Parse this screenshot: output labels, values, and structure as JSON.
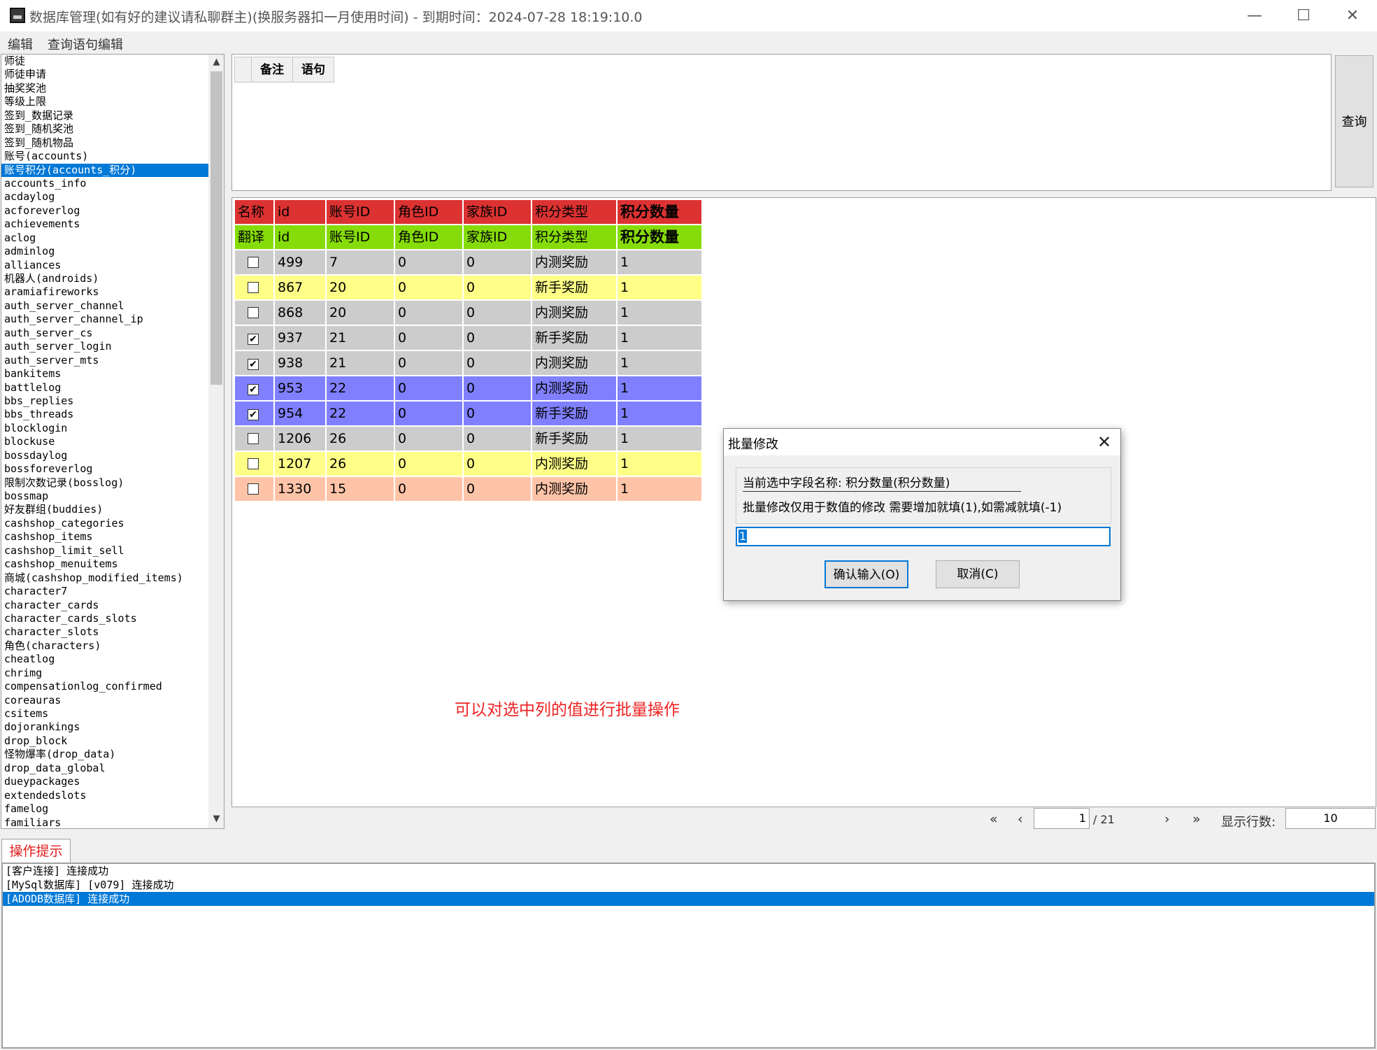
{
  "window": {
    "title": "数据库管理(如有好的建议请私聊群主)(换服务器扣一月使用时间) - 到期时间：2024-07-28 18:19:10.0",
    "minimize": "—",
    "maximize": "☐",
    "close": "✕"
  },
  "menu": [
    "编辑",
    "查询语句编辑"
  ],
  "table_list": [
    "师徒",
    "师徒申请",
    "抽奖奖池",
    "等级上限",
    "签到_数据记录",
    "签到_随机奖池",
    "签到_随机物品",
    "账号(accounts)",
    "账号积分(accounts_积分)",
    "accounts_info",
    "acdaylog",
    "acforeverlog",
    "achievements",
    "aclog",
    "adminlog",
    "alliances",
    "机器人(androids)",
    "aramiafireworks",
    "auth_server_channel",
    "auth_server_channel_ip",
    "auth_server_cs",
    "auth_server_login",
    "auth_server_mts",
    "bankitems",
    "battlelog",
    "bbs_replies",
    "bbs_threads",
    "blocklogin",
    "blockuse",
    "bossdaylog",
    "bossforeverlog",
    "限制次数记录(bosslog)",
    "bossmap",
    "好友群组(buddies)",
    "cashshop_categories",
    "cashshop_items",
    "cashshop_limit_sell",
    "cashshop_menuitems",
    "商城(cashshop_modified_items)",
    "character7",
    "character_cards",
    "character_cards_slots",
    "character_slots",
    "角色(characters)",
    "cheatlog",
    "chrimg",
    "compensationlog_confirmed",
    "coreauras",
    "csitems",
    "dojorankings",
    "drop_block",
    "怪物爆率(drop_data)",
    "drop_data_global",
    "dueypackages",
    "extendedslots",
    "famelog",
    "familiars"
  ],
  "scroll": {
    "up": "▲",
    "down": "▼"
  },
  "query": {
    "tabs": [
      "备注",
      "语句"
    ],
    "button": "查询"
  },
  "grid": {
    "header_name": [
      "名称",
      "id",
      "账号ID",
      "角色ID",
      "家族ID",
      "积分类型",
      "积分数量"
    ],
    "header_translate": [
      "翻译",
      "id",
      "账号ID",
      "角色ID",
      "家族ID",
      "积分类型",
      "积分数量"
    ],
    "rows": [
      {
        "checked": false,
        "id": "499",
        "account": "7",
        "char": "0",
        "family": "0",
        "type": "内测奖励",
        "amount": "1"
      },
      {
        "checked": false,
        "id": "867",
        "account": "20",
        "char": "0",
        "family": "0",
        "type": "新手奖励",
        "amount": "1"
      },
      {
        "checked": false,
        "id": "868",
        "account": "20",
        "char": "0",
        "family": "0",
        "type": "内测奖励",
        "amount": "1"
      },
      {
        "checked": true,
        "id": "937",
        "account": "21",
        "char": "0",
        "family": "0",
        "type": "新手奖励",
        "amount": "1"
      },
      {
        "checked": true,
        "id": "938",
        "account": "21",
        "char": "0",
        "family": "0",
        "type": "内测奖励",
        "amount": "1"
      },
      {
        "checked": true,
        "id": "953",
        "account": "22",
        "char": "0",
        "family": "0",
        "type": "内测奖励",
        "amount": "1"
      },
      {
        "checked": true,
        "id": "954",
        "account": "22",
        "char": "0",
        "family": "0",
        "type": "新手奖励",
        "amount": "1"
      },
      {
        "checked": false,
        "id": "1206",
        "account": "26",
        "char": "0",
        "family": "0",
        "type": "新手奖励",
        "amount": "1"
      },
      {
        "checked": false,
        "id": "1207",
        "account": "26",
        "char": "0",
        "family": "0",
        "type": "内测奖励",
        "amount": "1"
      },
      {
        "checked": false,
        "id": "1330",
        "account": "15",
        "char": "0",
        "family": "0",
        "type": "内测奖励",
        "amount": "1"
      }
    ],
    "row_colors": [
      "gray",
      "yellow",
      "gray",
      "gray",
      "gray",
      "blue",
      "blue",
      "gray",
      "yellow",
      "peach"
    ]
  },
  "annotation": "可以对选中列的值进行批量操作",
  "pager": {
    "first": "«",
    "prev": "‹",
    "page": "1",
    "total": "/ 21",
    "next": "›",
    "last": "»",
    "rows_label": "显示行数:",
    "rows_value": "10"
  },
  "log": {
    "tab": "操作提示",
    "lines": [
      "[客户连接] 连接成功",
      "[MySql数据库] [v079] 连接成功",
      "[ADODB数据库] 连接成功"
    ]
  },
  "dialog": {
    "title": "批量修改",
    "close": "✕",
    "field": "当前选中字段名称: 积分数量(积分数量)",
    "desc": "批量修改仅用于数值的修改    需要增加就填(1),如需减就填(-1)",
    "value": "1",
    "ok": "确认输入(O)",
    "cancel": "取消(C)"
  },
  "colors": {
    "selection": "#0078d7",
    "header_red": "#dc3232",
    "header_green": "#86dc0a",
    "row_gray": "#cccccc",
    "row_yellow": "#ffff88",
    "row_blue": "#8080ff",
    "row_peach": "#ffc4a8",
    "annotation": "#ee2222"
  }
}
